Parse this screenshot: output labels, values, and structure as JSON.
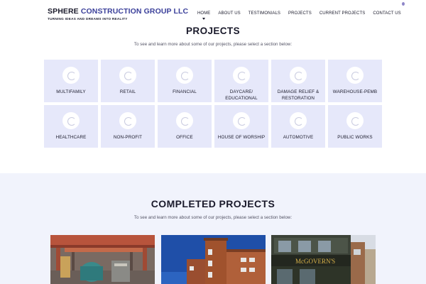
{
  "header": {
    "logo": {
      "title_primary": "SPHERE",
      "title_accent": "CONSTRUCTION",
      "title_rest": "GROUP LLC",
      "tagline": "TURNING IDEAS AND DREAMS INTO REALITY"
    },
    "nav": [
      {
        "label": "HOME",
        "active": true
      },
      {
        "label": "ABOUT US",
        "active": false
      },
      {
        "label": "TESTIMONIALS",
        "active": false
      },
      {
        "label": "PROJECTS",
        "active": false
      },
      {
        "label": "CURRENT PROJECTS",
        "active": false
      },
      {
        "label": "CONTACT US",
        "active": false
      }
    ]
  },
  "projects": {
    "title": "PROJECTS",
    "subtitle": "To see and learn more about some of our projects, please select a section below:",
    "cards": [
      {
        "label": "MULTIFAMILY"
      },
      {
        "label": "RETAIL"
      },
      {
        "label": "FINANCIAL"
      },
      {
        "label": "DAYCARE/ EDUCATIONAL"
      },
      {
        "label": "DAMAGE RELIEF & RESTORATION"
      },
      {
        "label": "WAREHOUSE-PEMB"
      },
      {
        "label": "HEALTHCARE"
      },
      {
        "label": "NON-PROFIT"
      },
      {
        "label": "OFFICE"
      },
      {
        "label": "HOUSE OF WORSHIP"
      },
      {
        "label": "AUTOMOTIVE"
      },
      {
        "label": "PUBLIC WORKS"
      }
    ]
  },
  "completed": {
    "title": "COMPLETED PROJECTS",
    "subtitle": "To see and learn more about some of our projects, please select a section below:",
    "photos": [
      {
        "name": "industrial-interior-photo"
      },
      {
        "name": "brick-building-photo"
      },
      {
        "name": "storefront-photo",
        "sign_text": "McGOVERN'S"
      }
    ]
  },
  "colors": {
    "accent": "#3a3f9a",
    "card_bg": "#e6e8fa",
    "band_bg": "#f1f3fc",
    "text": "#1a1a2b"
  }
}
